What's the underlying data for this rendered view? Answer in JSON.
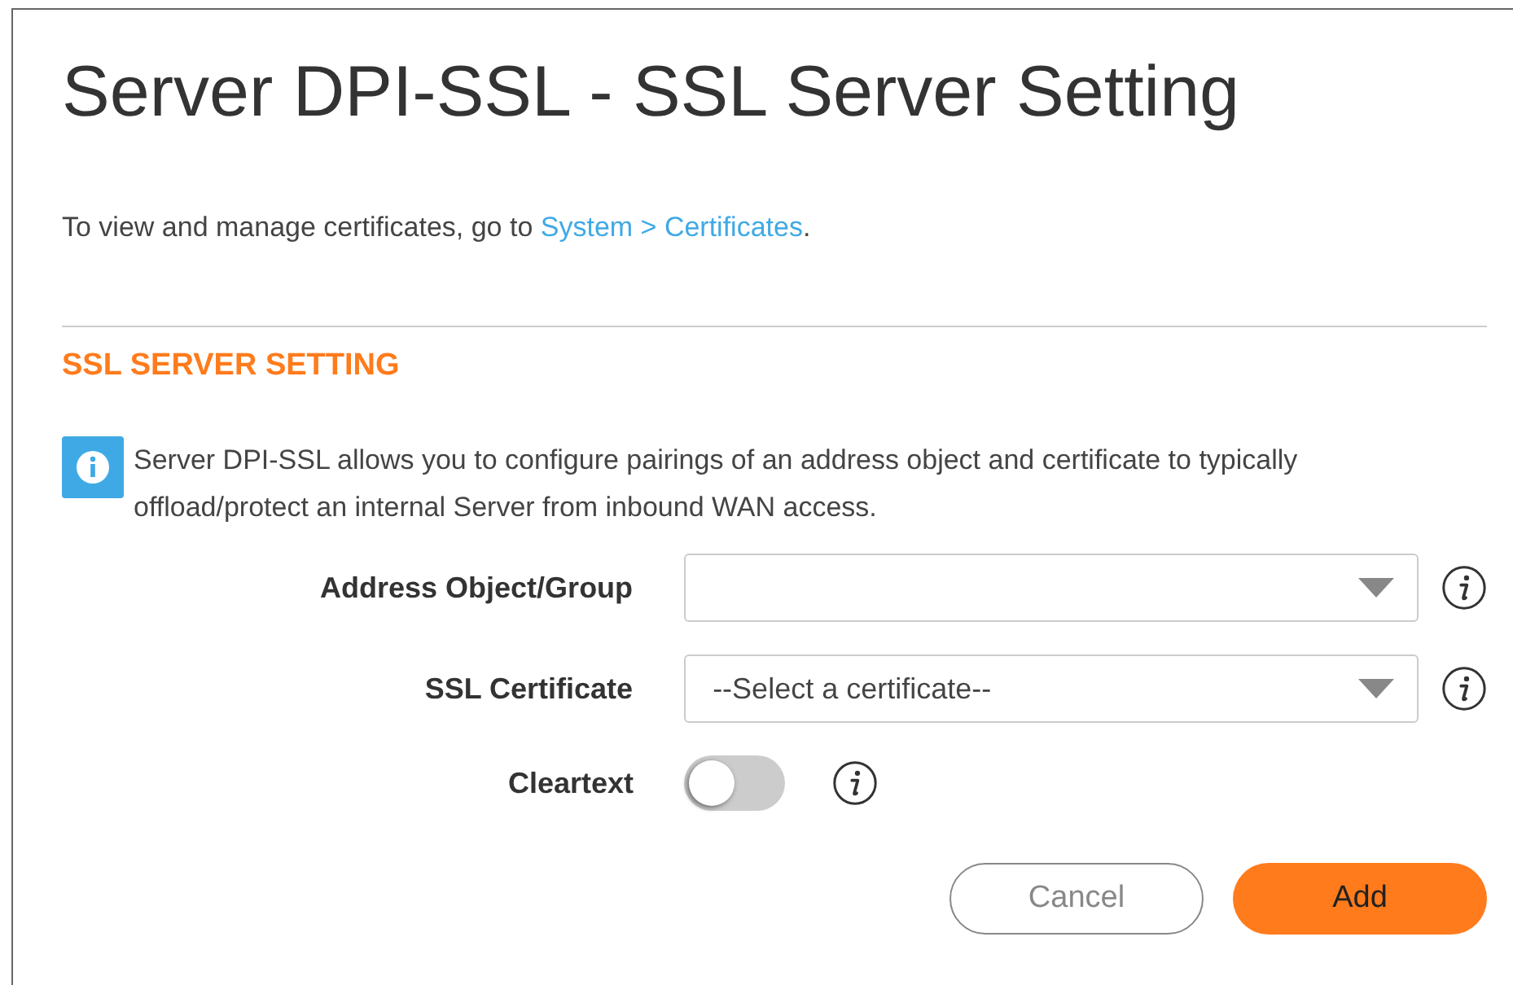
{
  "title": "Server DPI-SSL - SSL Server Setting",
  "intro": {
    "text": "To view and manage certificates, go to ",
    "link": "System > Certificates",
    "after": "."
  },
  "section": {
    "heading": "SSL SERVER SETTING",
    "info": "Server DPI-SSL allows you to configure pairings of an address object and certificate to typically offload/protect an internal Server from inbound WAN access."
  },
  "fields": [
    {
      "kind": "select",
      "label": "Address Object/Group"
    },
    {
      "kind": "select",
      "label": "SSL Certificate",
      "value": "--Select a certificate--"
    },
    {
      "kind": "toggle",
      "label": "Cleartext",
      "on": false
    }
  ],
  "buttons": [
    {
      "label": "Cancel",
      "kind": "secondary"
    },
    {
      "label": "Add",
      "kind": "primary"
    }
  ]
}
